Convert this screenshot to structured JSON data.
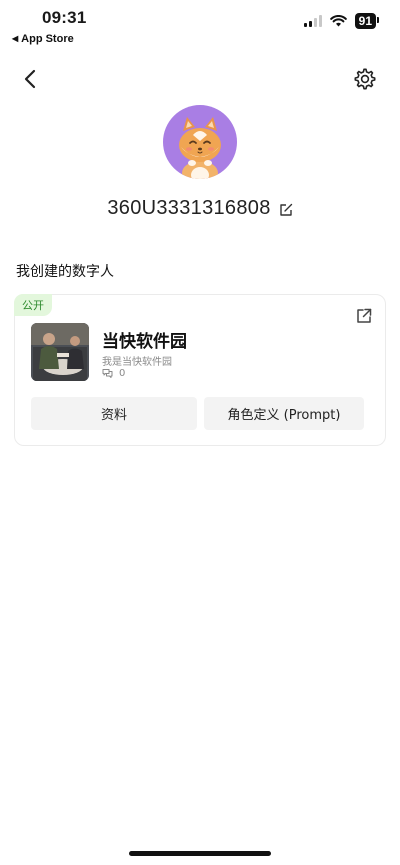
{
  "status_bar": {
    "time": "09:31",
    "back_app": "App Store",
    "battery": "91"
  },
  "nav": {
    "back_icon": "chevron-left-icon",
    "settings_icon": "gear-icon"
  },
  "profile": {
    "avatar": "fox-avatar",
    "username": "360U3331316808",
    "edit_icon": "edit-icon"
  },
  "section": {
    "title": "我创建的数字人"
  },
  "bot_card": {
    "badge": "公开",
    "name": "当快软件园",
    "description": "我是当快软件园",
    "chat_count": "0",
    "share_icon": "external-link-icon",
    "buttons": {
      "profile": "资料",
      "role": "角色定义 (Prompt)"
    }
  },
  "colors": {
    "avatar_bg": "#a97ee4",
    "badge_bg": "#e3f7dc",
    "badge_text": "#2e8b2e",
    "button_bg": "#f3f3f3"
  }
}
